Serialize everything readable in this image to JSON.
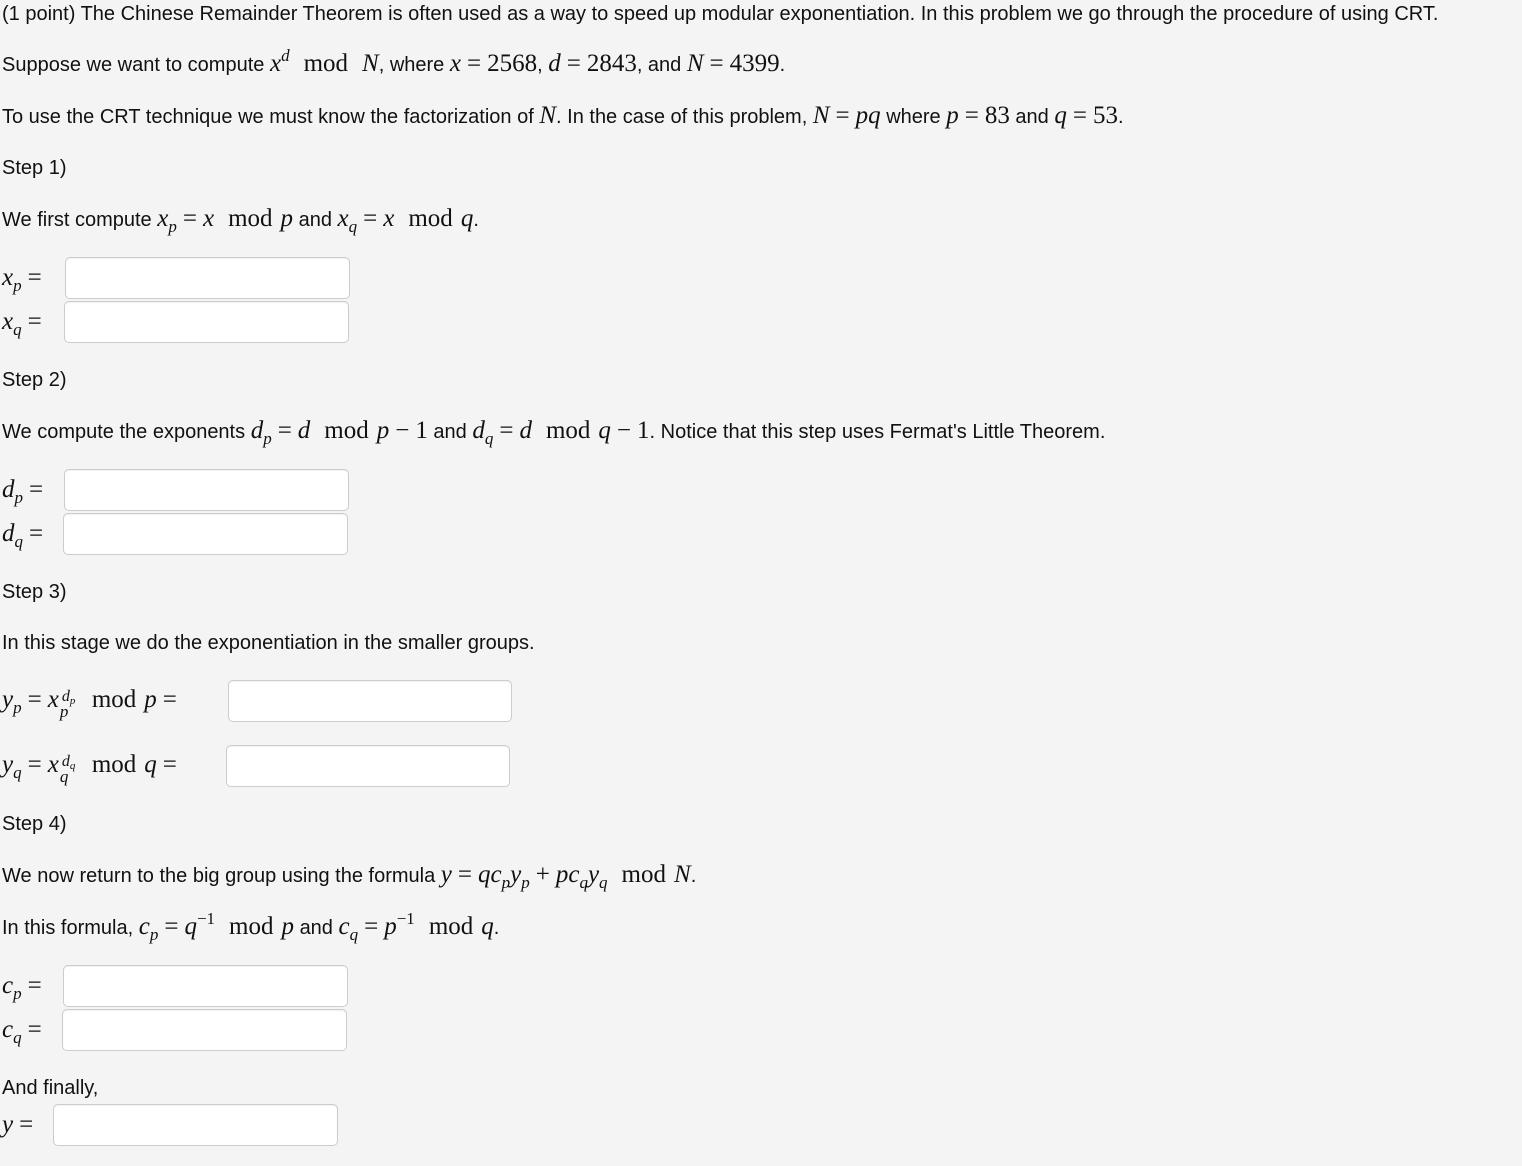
{
  "intro": {
    "points": "(1 point)",
    "text": "The Chinese Remainder Theorem is often used as a way to speed up modular exponentiation. In this problem we go through the procedure of using CRT."
  },
  "setup": {
    "prefix": "Suppose we want to compute",
    "where": ", where",
    "and": ", and",
    "x_value": "2568",
    "d_value": "2843",
    "N_value": "4399"
  },
  "factor": {
    "prefix": "To use the CRT technique we must know the factorization of",
    "middle": ". In the case of this problem,",
    "where": "where",
    "and": "and",
    "p_value": "83",
    "q_value": "53"
  },
  "steps": [
    {
      "title": "Step 1)",
      "text_prefix": "We first compute",
      "text_and": "and",
      "fields": [
        {
          "name": "x_p",
          "value": "",
          "placeholder": ""
        },
        {
          "name": "x_q",
          "value": "",
          "placeholder": ""
        }
      ]
    },
    {
      "title": "Step 2)",
      "text_prefix": "We compute the exponents",
      "text_and": "and",
      "text_suffix": ". Notice that this step uses Fermat's Little Theorem.",
      "fields": [
        {
          "name": "d_p",
          "value": "",
          "placeholder": ""
        },
        {
          "name": "d_q",
          "value": "",
          "placeholder": ""
        }
      ]
    },
    {
      "title": "Step 3)",
      "text": "In this stage we do the exponentiation in the smaller groups.",
      "fields": [
        {
          "name": "y_p",
          "value": "",
          "placeholder": ""
        },
        {
          "name": "y_q",
          "value": "",
          "placeholder": ""
        }
      ]
    },
    {
      "title": "Step 4)",
      "text_prefix": "We now return to the big group using the formula",
      "formula_text_prefix": "In this formula,",
      "formula_text_and": "and",
      "fields": [
        {
          "name": "c_p",
          "value": "",
          "placeholder": ""
        },
        {
          "name": "c_q",
          "value": "",
          "placeholder": ""
        }
      ]
    }
  ],
  "final": {
    "text": "And finally,",
    "field": {
      "name": "y",
      "value": "",
      "placeholder": ""
    }
  },
  "math": {
    "mod": "mod",
    "equals": "=",
    "minus_one": "1",
    "inverse_exp": "−1"
  }
}
